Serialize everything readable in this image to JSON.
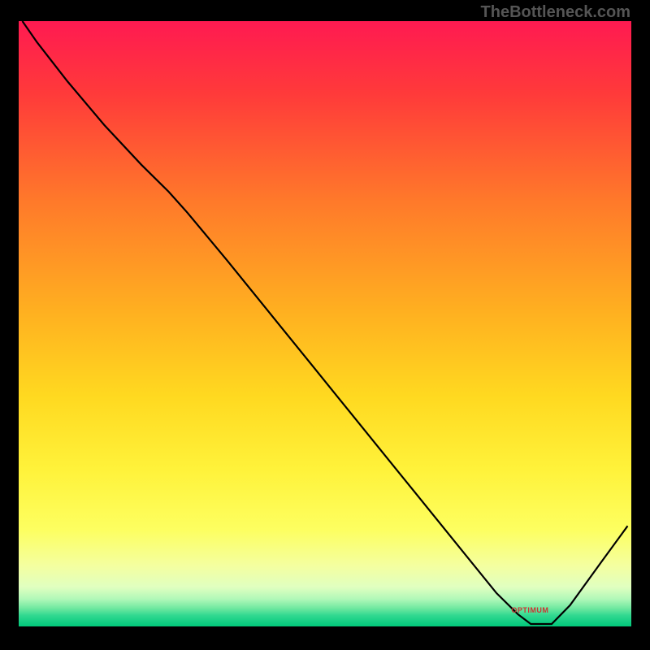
{
  "watermark": "TheBottleneck.com",
  "chart_data": {
    "type": "line",
    "title": "",
    "xlabel": "",
    "ylabel": "",
    "xlim": [
      0,
      100
    ],
    "ylim": [
      0,
      100
    ],
    "grid": false,
    "legend": false,
    "annotations": [
      {
        "text": "OPTIMUM",
        "x": 83.6,
        "y": 2.5
      }
    ],
    "gradient_stops": [
      {
        "pct": 0,
        "color": "#ff1a51"
      },
      {
        "pct": 12,
        "color": "#ff3a3a"
      },
      {
        "pct": 30,
        "color": "#ff7a2a"
      },
      {
        "pct": 48,
        "color": "#ffb020"
      },
      {
        "pct": 62,
        "color": "#ffd920"
      },
      {
        "pct": 74,
        "color": "#fff23a"
      },
      {
        "pct": 84,
        "color": "#fdff60"
      },
      {
        "pct": 90,
        "color": "#f4ffa0"
      },
      {
        "pct": 93.5,
        "color": "#e0ffc0"
      },
      {
        "pct": 95.5,
        "color": "#b0f8b8"
      },
      {
        "pct": 97,
        "color": "#70e8a0"
      },
      {
        "pct": 98.2,
        "color": "#30d890"
      },
      {
        "pct": 100,
        "color": "#00c87a"
      }
    ],
    "series": [
      {
        "name": "bottleneck-curve",
        "points": [
          {
            "x": 0.6,
            "y": 100.0
          },
          {
            "x": 3.0,
            "y": 96.5
          },
          {
            "x": 8.0,
            "y": 90.0
          },
          {
            "x": 14.0,
            "y": 82.8
          },
          {
            "x": 20.0,
            "y": 76.3
          },
          {
            "x": 24.5,
            "y": 71.8
          },
          {
            "x": 27.5,
            "y": 68.4
          },
          {
            "x": 34.0,
            "y": 60.5
          },
          {
            "x": 42.0,
            "y": 50.5
          },
          {
            "x": 52.0,
            "y": 38.0
          },
          {
            "x": 62.0,
            "y": 25.5
          },
          {
            "x": 72.0,
            "y": 13.0
          },
          {
            "x": 78.0,
            "y": 5.5
          },
          {
            "x": 81.5,
            "y": 2.0
          },
          {
            "x": 83.6,
            "y": 0.4
          },
          {
            "x": 87.0,
            "y": 0.4
          },
          {
            "x": 90.0,
            "y": 3.5
          },
          {
            "x": 95.0,
            "y": 10.5
          },
          {
            "x": 99.4,
            "y": 16.6
          }
        ]
      }
    ]
  }
}
